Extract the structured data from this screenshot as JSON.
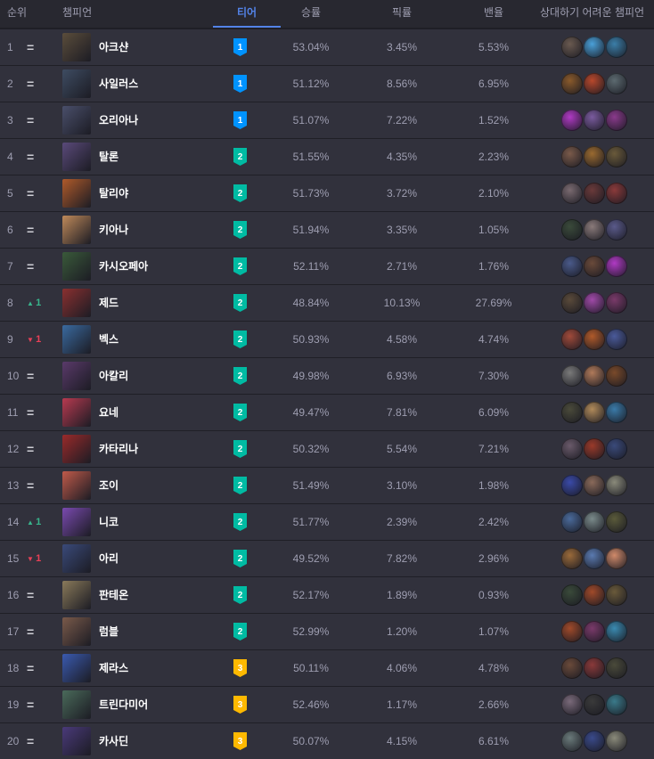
{
  "header": {
    "rank": "순위",
    "champion": "챔피언",
    "tier": "티어",
    "win_rate": "승률",
    "pick_rate": "픽률",
    "ban_rate": "밴율",
    "counters": "상대하기 어려운 챔피언"
  },
  "rows": [
    {
      "rank": "1",
      "change": "=",
      "dir": "eq",
      "name": "아크샨",
      "tier": "1",
      "win": "53.04%",
      "pick": "3.45%",
      "ban": "5.53%",
      "color": "#5b4d3b",
      "counters": [
        "#6a5a50",
        "#4aa0d8",
        "#3b7ea8"
      ]
    },
    {
      "rank": "2",
      "change": "=",
      "dir": "eq",
      "name": "사일러스",
      "tier": "1",
      "win": "51.12%",
      "pick": "8.56%",
      "ban": "6.95%",
      "color": "#3e4c62",
      "counters": [
        "#8a5a2b",
        "#b8482c",
        "#5c6a70"
      ]
    },
    {
      "rank": "3",
      "change": "=",
      "dir": "eq",
      "name": "오리아나",
      "tier": "1",
      "win": "51.07%",
      "pick": "7.22%",
      "ban": "1.52%",
      "color": "#4a4f6b",
      "counters": [
        "#b03ac4",
        "#7a5b9e",
        "#8a3a8c"
      ]
    },
    {
      "rank": "4",
      "change": "=",
      "dir": "eq",
      "name": "탈론",
      "tier": "2",
      "win": "51.55%",
      "pick": "4.35%",
      "ban": "2.23%",
      "color": "#5a4a7a",
      "counters": [
        "#7a5a4a",
        "#9a6a30",
        "#6a5a3a"
      ]
    },
    {
      "rank": "5",
      "change": "=",
      "dir": "eq",
      "name": "탈리야",
      "tier": "2",
      "win": "51.73%",
      "pick": "3.72%",
      "ban": "2.10%",
      "color": "#b05a2a",
      "counters": [
        "#7a6a70",
        "#6a3a3a",
        "#8a3a3a"
      ]
    },
    {
      "rank": "6",
      "change": "=",
      "dir": "eq",
      "name": "키아나",
      "tier": "2",
      "win": "51.94%",
      "pick": "3.35%",
      "ban": "1.05%",
      "color": "#c08a5a",
      "counters": [
        "#3a4a3a",
        "#8a7a7a",
        "#5a5a8a"
      ]
    },
    {
      "rank": "7",
      "change": "=",
      "dir": "eq",
      "name": "카시오페아",
      "tier": "2",
      "win": "52.11%",
      "pick": "2.71%",
      "ban": "1.76%",
      "color": "#3a5a3a",
      "counters": [
        "#4a5a8a",
        "#6a4a3a",
        "#b03ac4"
      ]
    },
    {
      "rank": "8",
      "change": "1",
      "dir": "up",
      "name": "제드",
      "tier": "2",
      "win": "48.84%",
      "pick": "10.13%",
      "ban": "27.69%",
      "color": "#8a3030",
      "counters": [
        "#5a4a3a",
        "#a04aa8",
        "#7a3a6a"
      ]
    },
    {
      "rank": "9",
      "change": "1",
      "dir": "down",
      "name": "벡스",
      "tier": "2",
      "win": "50.93%",
      "pick": "4.58%",
      "ban": "4.74%",
      "color": "#3a6aa0",
      "counters": [
        "#a04a3a",
        "#b05a2a",
        "#4a5a9a"
      ]
    },
    {
      "rank": "10",
      "change": "=",
      "dir": "eq",
      "name": "아칼리",
      "tier": "2",
      "win": "49.98%",
      "pick": "6.93%",
      "ban": "7.30%",
      "color": "#5a3a6a",
      "counters": [
        "#7a7a7a",
        "#b07a5a",
        "#7a4a2a"
      ]
    },
    {
      "rank": "11",
      "change": "=",
      "dir": "eq",
      "name": "요네",
      "tier": "2",
      "win": "49.47%",
      "pick": "7.81%",
      "ban": "6.09%",
      "color": "#b83a50",
      "counters": [
        "#4a4a3a",
        "#b08a5a",
        "#3a7aa8"
      ]
    },
    {
      "rank": "12",
      "change": "=",
      "dir": "eq",
      "name": "카타리나",
      "tier": "2",
      "win": "50.32%",
      "pick": "5.54%",
      "ban": "7.21%",
      "color": "#9a2a2a",
      "counters": [
        "#6a5a6a",
        "#9a3a2a",
        "#3a4a7a"
      ]
    },
    {
      "rank": "13",
      "change": "=",
      "dir": "eq",
      "name": "조이",
      "tier": "2",
      "win": "51.49%",
      "pick": "3.10%",
      "ban": "1.98%",
      "color": "#c05a4a",
      "counters": [
        "#3a4aa8",
        "#8a6a5a",
        "#8a8a7a"
      ]
    },
    {
      "rank": "14",
      "change": "1",
      "dir": "up",
      "name": "니코",
      "tier": "2",
      "win": "51.77%",
      "pick": "2.39%",
      "ban": "2.42%",
      "color": "#7a4ab0",
      "counters": [
        "#4a6a9a",
        "#7a8a8a",
        "#5a5a3a"
      ]
    },
    {
      "rank": "15",
      "change": "1",
      "dir": "down",
      "name": "아리",
      "tier": "2",
      "win": "49.52%",
      "pick": "7.82%",
      "ban": "2.96%",
      "color": "#3a4a7a",
      "counters": [
        "#9a6a3a",
        "#5a7ab0",
        "#d08a6a"
      ]
    },
    {
      "rank": "16",
      "change": "=",
      "dir": "eq",
      "name": "판테온",
      "tier": "2",
      "win": "52.17%",
      "pick": "1.89%",
      "ban": "0.93%",
      "color": "#8a7a5a",
      "counters": [
        "#3a4a3a",
        "#a04a2a",
        "#6a5a3a"
      ]
    },
    {
      "rank": "17",
      "change": "=",
      "dir": "eq",
      "name": "럼블",
      "tier": "2",
      "win": "52.99%",
      "pick": "1.20%",
      "ban": "1.07%",
      "color": "#7a5a4a",
      "counters": [
        "#a04a2a",
        "#7a3a6a",
        "#3a8ab0"
      ]
    },
    {
      "rank": "18",
      "change": "=",
      "dir": "eq",
      "name": "제라스",
      "tier": "3",
      "win": "50.11%",
      "pick": "4.06%",
      "ban": "4.78%",
      "color": "#3a5ab0",
      "counters": [
        "#6a4a3a",
        "#8a3a3a",
        "#4a4a3a"
      ]
    },
    {
      "rank": "19",
      "change": "=",
      "dir": "eq",
      "name": "트린다미어",
      "tier": "3",
      "win": "52.46%",
      "pick": "1.17%",
      "ban": "2.66%",
      "color": "#4a6a5a",
      "counters": [
        "#7a6a7a",
        "#3a3a3a",
        "#3a7a8a"
      ]
    },
    {
      "rank": "20",
      "change": "=",
      "dir": "eq",
      "name": "카사딘",
      "tier": "3",
      "win": "50.07%",
      "pick": "4.15%",
      "ban": "6.61%",
      "color": "#4a3a7a",
      "counters": [
        "#6a7a7a",
        "#3a4a8a",
        "#8a8a7a"
      ]
    }
  ],
  "tier_colors": {
    "1": "#0093ff",
    "2": "#00bba3",
    "3": "#ffb900"
  },
  "change_icons": {
    "up": "triangle-up-icon",
    "down": "triangle-down-icon"
  }
}
